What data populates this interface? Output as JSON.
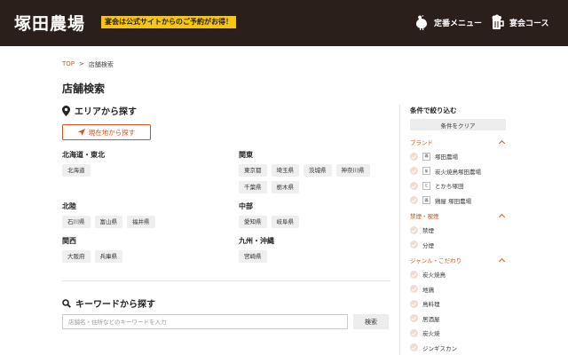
{
  "header": {
    "logo": "塚田農場",
    "promo": "宴会は公式サイトからのご予約がお得！",
    "nav": [
      {
        "label": "定番メニュー",
        "icon": "chicken-icon"
      },
      {
        "label": "宴会コース",
        "icon": "beer-icon"
      }
    ]
  },
  "breadcrumb": {
    "home": "TOP",
    "separator": ">",
    "current": "店舗検索"
  },
  "page_title": "店舗検索",
  "area": {
    "heading": "エリアから探す",
    "locate_button": "現在地から探す",
    "regions": [
      {
        "name": "北海道・東北",
        "prefs": [
          "北海道"
        ]
      },
      {
        "name": "関東",
        "prefs": [
          "東京都",
          "埼玉県",
          "茨城県",
          "神奈川県",
          "千葉県",
          "栃木県"
        ]
      },
      {
        "name": "北陸",
        "prefs": [
          "石川県",
          "富山県",
          "福井県"
        ]
      },
      {
        "name": "中部",
        "prefs": [
          "愛知県",
          "岐阜県"
        ]
      },
      {
        "name": "関西",
        "prefs": [
          "大阪府",
          "兵庫県"
        ]
      },
      {
        "name": "九州・沖縄",
        "prefs": [
          "宮崎県"
        ]
      }
    ]
  },
  "keyword": {
    "heading": "キーワードから探す",
    "placeholder": "店舗名・住所などのキーワードを入力",
    "value": "",
    "button": "検索"
  },
  "sidebar": {
    "title": "条件で絞り込む",
    "clear_button": "条件をクリア",
    "groups": [
      {
        "name": "ブランド",
        "options": [
          "塚田農場",
          "炭火焼鳥塚田農場",
          "とかち塚田",
          "鶏屋 塚田農場"
        ]
      },
      {
        "name": "禁煙・喫煙",
        "options": [
          "禁煙",
          "分煙"
        ]
      },
      {
        "name": "ジャンル・こだわり",
        "options": [
          "炭火焼鳥",
          "地鶏",
          "鳥料理",
          "居酒屋",
          "炭火焼",
          "ジンギスカン"
        ]
      }
    ]
  },
  "colors": {
    "accent": "#c65a1e",
    "header_bg": "#2a1f1a",
    "promo_bg": "#f5c518"
  }
}
